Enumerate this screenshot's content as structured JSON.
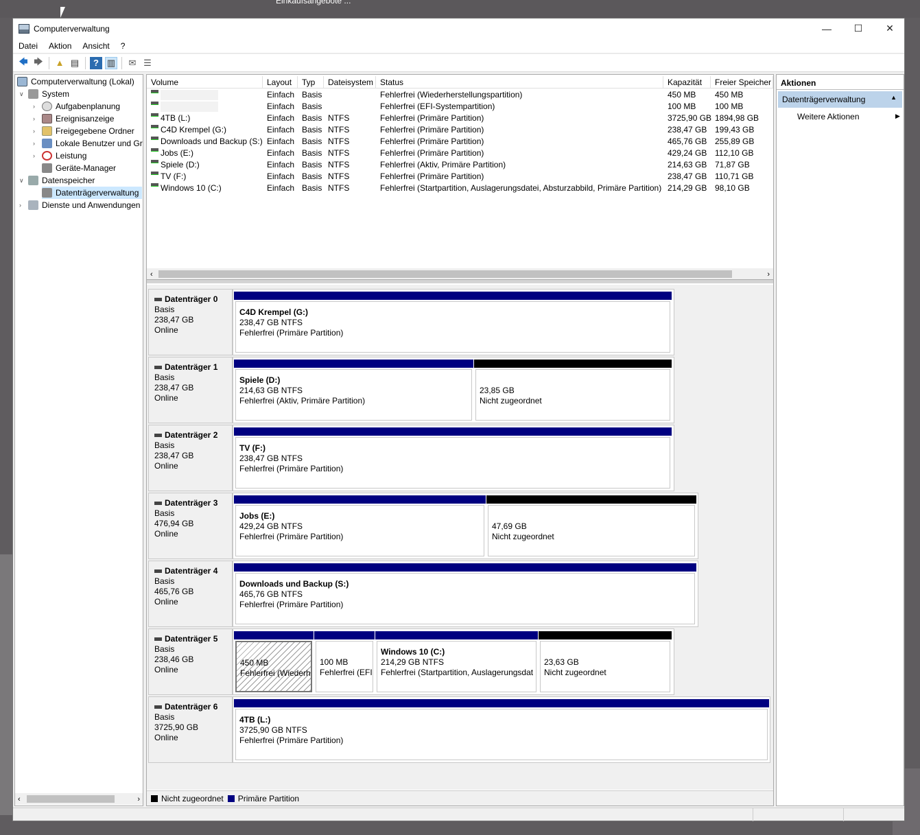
{
  "desktop": {
    "bg_title": "Einkaufsangebote ..."
  },
  "window": {
    "title": "Computerverwaltung",
    "minimize": "—",
    "maximize": "☐",
    "close": "✕"
  },
  "menu": [
    "Datei",
    "Aktion",
    "Ansicht",
    "?"
  ],
  "tree": {
    "root": "Computerverwaltung (Lokal)",
    "system": "System",
    "aufgaben": "Aufgabenplanung",
    "ereignis": "Ereignisanzeige",
    "freigabe": "Freigegebene Ordner",
    "benutzer": "Lokale Benutzer und Gru",
    "leistung": "Leistung",
    "geraete": "Geräte-Manager",
    "datenspeicher": "Datenspeicher",
    "datentraeger": "Datenträgerverwaltung",
    "dienste": "Dienste und Anwendungen"
  },
  "list": {
    "columns": [
      "Volume",
      "Layout",
      "Typ",
      "Dateisystem",
      "Status",
      "Kapazität",
      "Freier Speicher"
    ],
    "rows": [
      {
        "volume": "",
        "layout": "Einfach",
        "typ": "Basis",
        "fs": "",
        "status": "Fehlerfrei (Wiederherstellungspartition)",
        "kap": "450 MB",
        "frei": "450 MB"
      },
      {
        "volume": "",
        "layout": "Einfach",
        "typ": "Basis",
        "fs": "",
        "status": "Fehlerfrei (EFI-Systempartition)",
        "kap": "100 MB",
        "frei": "100 MB"
      },
      {
        "volume": "4TB (L:)",
        "layout": "Einfach",
        "typ": "Basis",
        "fs": "NTFS",
        "status": "Fehlerfrei (Primäre Partition)",
        "kap": "3725,90 GB",
        "frei": "1894,98 GB"
      },
      {
        "volume": "C4D Krempel (G:)",
        "layout": "Einfach",
        "typ": "Basis",
        "fs": "NTFS",
        "status": "Fehlerfrei (Primäre Partition)",
        "kap": "238,47 GB",
        "frei": "199,43 GB"
      },
      {
        "volume": "Downloads und Backup (S:)",
        "layout": "Einfach",
        "typ": "Basis",
        "fs": "NTFS",
        "status": "Fehlerfrei (Primäre Partition)",
        "kap": "465,76 GB",
        "frei": "255,89 GB"
      },
      {
        "volume": "Jobs (E:)",
        "layout": "Einfach",
        "typ": "Basis",
        "fs": "NTFS",
        "status": "Fehlerfrei (Primäre Partition)",
        "kap": "429,24 GB",
        "frei": "112,10 GB"
      },
      {
        "volume": "Spiele (D:)",
        "layout": "Einfach",
        "typ": "Basis",
        "fs": "NTFS",
        "status": "Fehlerfrei (Aktiv, Primäre Partition)",
        "kap": "214,63 GB",
        "frei": "71,87 GB"
      },
      {
        "volume": "TV (F:)",
        "layout": "Einfach",
        "typ": "Basis",
        "fs": "NTFS",
        "status": "Fehlerfrei (Primäre Partition)",
        "kap": "238,47 GB",
        "frei": "110,71 GB"
      },
      {
        "volume": "Windows 10 (C:)",
        "layout": "Einfach",
        "typ": "Basis",
        "fs": "NTFS",
        "status": "Fehlerfrei (Startpartition, Auslagerungsdatei, Absturzabbild, Primäre Partition)",
        "kap": "214,29 GB",
        "frei": "98,10 GB"
      }
    ]
  },
  "disks": [
    {
      "name": "Datenträger 0",
      "type": "Basis",
      "size": "238,47 GB",
      "state": "Online",
      "parts": [
        {
          "title": "C4D Krempel  (G:)",
          "line2": "238,47 GB NTFS",
          "line3": "Fehlerfrei (Primäre Partition)"
        }
      ]
    },
    {
      "name": "Datenträger 1",
      "type": "Basis",
      "size": "238,47 GB",
      "state": "Online",
      "parts": [
        {
          "title": "Spiele  (D:)",
          "line2": "214,63 GB NTFS",
          "line3": "Fehlerfrei (Aktiv, Primäre Partition)"
        },
        {
          "title": "",
          "line2": "23,85 GB",
          "line3": "Nicht zugeordnet"
        }
      ]
    },
    {
      "name": "Datenträger 2",
      "type": "Basis",
      "size": "238,47 GB",
      "state": "Online",
      "parts": [
        {
          "title": "TV  (F:)",
          "line2": "238,47 GB NTFS",
          "line3": "Fehlerfrei (Primäre Partition)"
        }
      ]
    },
    {
      "name": "Datenträger 3",
      "type": "Basis",
      "size": "476,94 GB",
      "state": "Online",
      "parts": [
        {
          "title": "Jobs  (E:)",
          "line2": "429,24 GB NTFS",
          "line3": "Fehlerfrei (Primäre Partition)"
        },
        {
          "title": "",
          "line2": "47,69 GB",
          "line3": "Nicht zugeordnet"
        }
      ]
    },
    {
      "name": "Datenträger 4",
      "type": "Basis",
      "size": "465,76 GB",
      "state": "Online",
      "parts": [
        {
          "title": "Downloads und Backup  (S:)",
          "line2": "465,76 GB NTFS",
          "line3": "Fehlerfrei (Primäre Partition)"
        }
      ]
    },
    {
      "name": "Datenträger 5",
      "type": "Basis",
      "size": "238,46 GB",
      "state": "Online",
      "parts": [
        {
          "title": "",
          "line2": "450 MB",
          "line3": "Fehlerfrei (Wiederh"
        },
        {
          "title": "",
          "line2": "100 MB",
          "line3": "Fehlerfrei (EFI-"
        },
        {
          "title": "Windows 10  (C:)",
          "line2": "214,29 GB NTFS",
          "line3": "Fehlerfrei (Startpartition, Auslagerungsdat"
        },
        {
          "title": "",
          "line2": "23,63 GB",
          "line3": "Nicht zugeordnet"
        }
      ]
    },
    {
      "name": "Datenträger 6",
      "type": "Basis",
      "size": "3725,90 GB",
      "state": "Online",
      "parts": [
        {
          "title": "4TB  (L:)",
          "line2": "3725,90 GB NTFS",
          "line3": "Fehlerfrei (Primäre Partition)"
        }
      ]
    }
  ],
  "legend": {
    "unalloc": "Nicht zugeordnet",
    "primary": "Primäre Partition"
  },
  "colors": {
    "primary": "#000080",
    "unalloc": "#000000",
    "selection": "#bcd3ea"
  },
  "actions": {
    "header": "Aktionen",
    "section": "Datenträgerverwaltung",
    "more": "Weitere Aktionen"
  }
}
